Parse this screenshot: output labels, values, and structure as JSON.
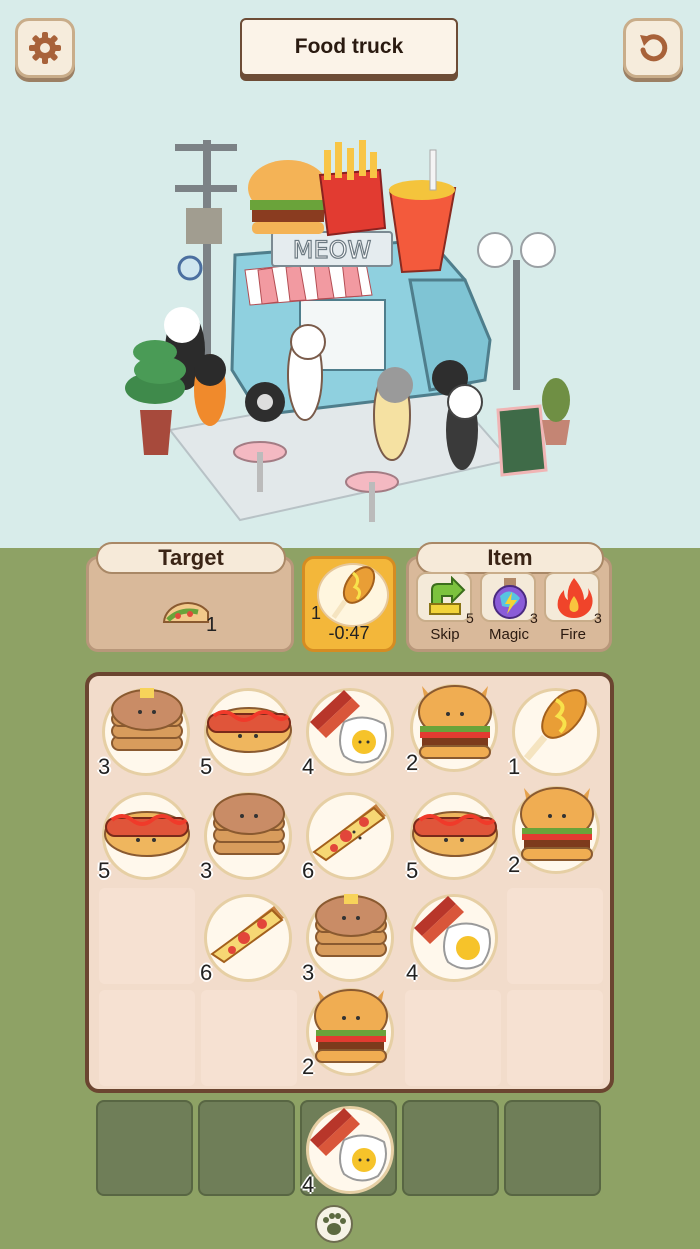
{
  "header": {
    "title": "Food truck",
    "settings_icon": "gear-icon",
    "restart_icon": "restart-icon"
  },
  "scene": {
    "sign": "MEOW"
  },
  "target": {
    "label": "Target",
    "food": "taco",
    "count": "1"
  },
  "timer": {
    "food": "corndog",
    "count": "1",
    "time": "-0:47"
  },
  "items": {
    "label": "Item",
    "list": [
      {
        "name": "Skip",
        "icon": "skip-arrow-icon",
        "count": "5",
        "color": "#7cc23e"
      },
      {
        "name": "Magic",
        "icon": "magic-potion-icon",
        "count": "3",
        "color": "#8a5cd8"
      },
      {
        "name": "Fire",
        "icon": "fire-icon",
        "count": "3",
        "color": "#f0442a"
      }
    ]
  },
  "board": {
    "rows": [
      [
        {
          "food": "pancakes",
          "count": "3"
        },
        {
          "food": "hotdog",
          "count": "5"
        },
        {
          "food": "bacon-egg",
          "count": "4"
        },
        {
          "food": "burger",
          "count": "2"
        },
        {
          "food": "corndog",
          "count": "1"
        }
      ],
      [
        {
          "food": "hotdog",
          "count": "5"
        },
        {
          "food": "pancakes",
          "count": "3"
        },
        {
          "food": "pizza",
          "count": "6"
        },
        {
          "food": "hotdog",
          "count": "5"
        },
        {
          "food": "burger",
          "count": "2"
        }
      ],
      [
        null,
        {
          "food": "pizza",
          "count": "6"
        },
        {
          "food": "pancakes",
          "count": "3"
        },
        {
          "food": "bacon-egg",
          "count": "4"
        },
        null
      ],
      [
        null,
        null,
        {
          "food": "burger",
          "count": "2"
        },
        null,
        null
      ]
    ]
  },
  "tray": [
    null,
    null,
    {
      "food": "bacon-egg",
      "count": "4"
    },
    null,
    null
  ],
  "footer": {
    "icon": "paw-icon"
  }
}
